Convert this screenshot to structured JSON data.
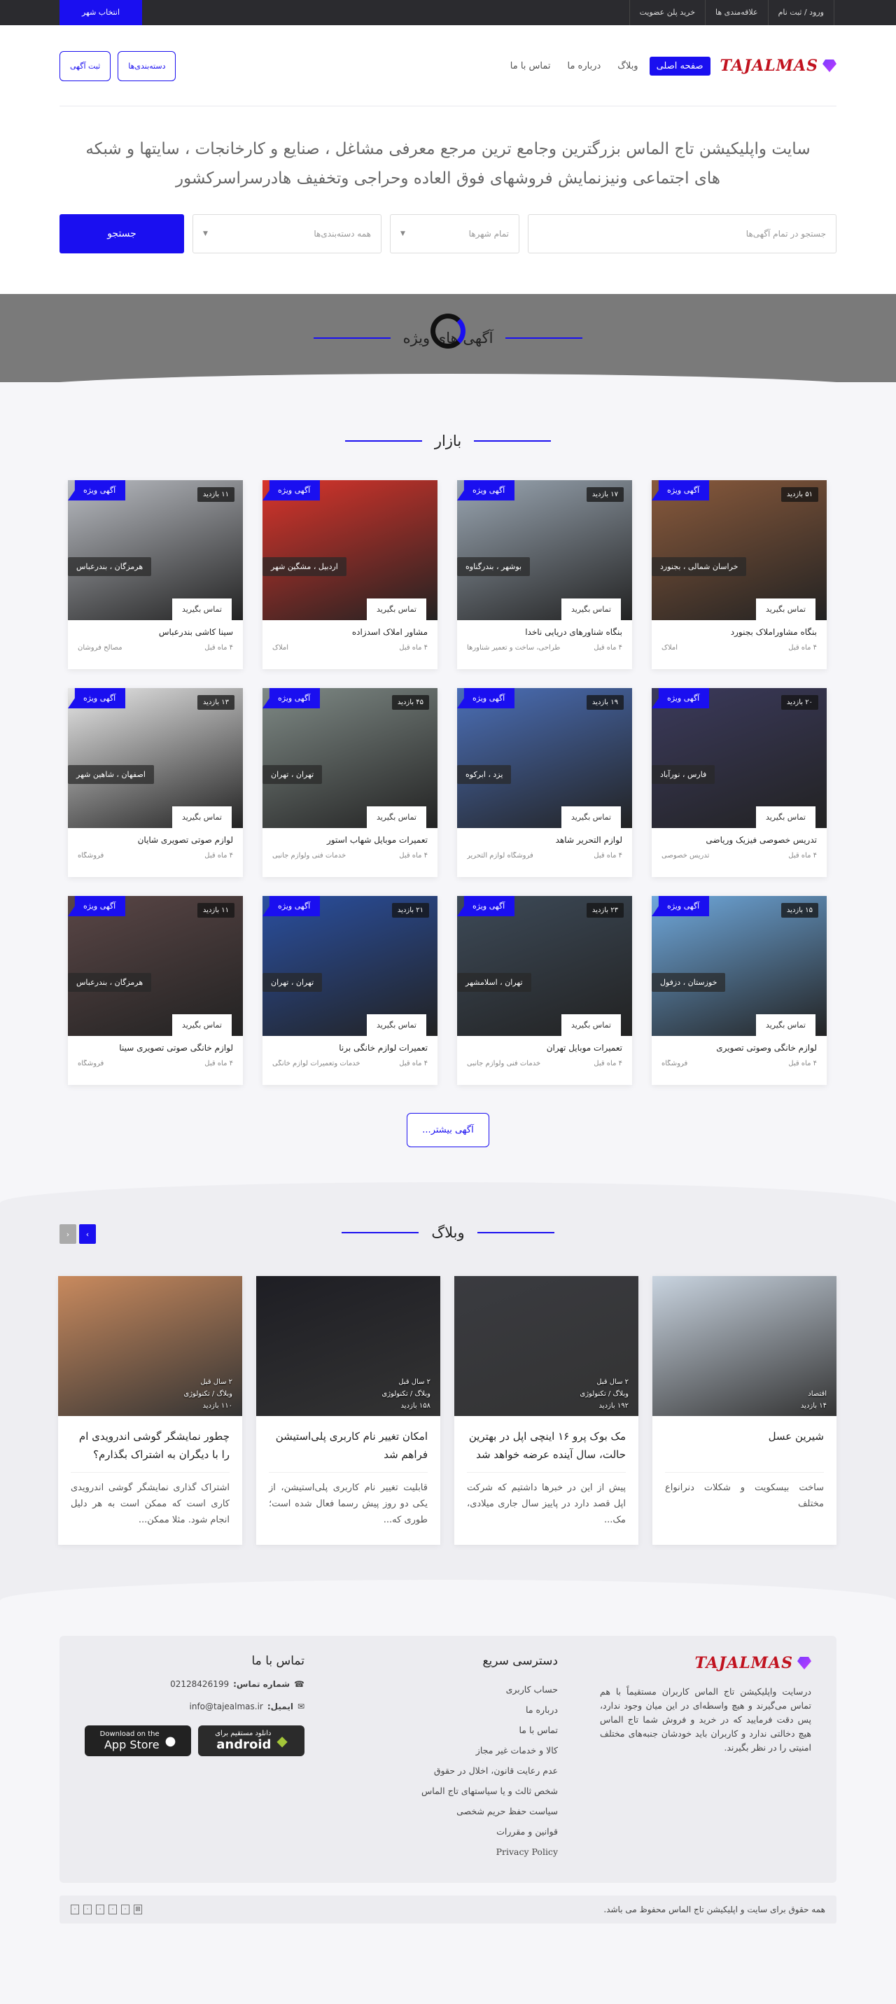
{
  "topbar": {
    "links": [
      "ورود / ثبت نام",
      "علاقه‌مندی ها",
      "خرید پلن عضویت"
    ],
    "city_button": "انتخاب شهر"
  },
  "header": {
    "logo": "TAJALMAS",
    "nav": [
      "صفحه اصلی",
      "وبلاگ",
      "درباره ما",
      "تماس با ما"
    ],
    "buttons": [
      "دسته‌بندی‌ها",
      "ثبت آگهی"
    ]
  },
  "hero": {
    "text": "سایت واپلیکیشن تاج الماس بزرگترین وجامع ترین مرجع معرفی مشاغل ، صنایع و کارخانجات ، سایتها و شبکه های اجتماعی  ونیزنمایش فروشهای فوق العاده وحراجی وتخفیف هادرسراسرکشور",
    "search_placeholder": "جستجو در تمام آگهی‌ها",
    "city_select": "تمام شهرها",
    "category_select": "همه دسته‌بندی‌ها",
    "search_button": "جستجو"
  },
  "featured": {
    "title": "آگهی های ویژه"
  },
  "market": {
    "title": "بازار",
    "contact_label": "تماس بگیرید",
    "featured_label": "آگهی ویژه",
    "items": [
      {
        "title": "بنگاه مشاوراملاک بجنورد",
        "location": "خراسان شمالی ، بجنورد",
        "views": "۵۱ بازدید",
        "time": "۴ ماه قبل",
        "category": "املاک",
        "featured": true,
        "color": "#8a5a3c"
      },
      {
        "title": "بنگاه شناورهای دریایی ناخدا",
        "location": "بوشهر ، بندرگناوه",
        "views": "۱۷ بازدید",
        "time": "۴ ماه قبل",
        "category": "طراحی، ساخت و تعمیر شناورها",
        "featured": true,
        "color": "#9aa6b2"
      },
      {
        "title": "مشاور املاک اسدزاده",
        "location": "اردبیل ، مشگین شهر",
        "views": "",
        "time": "۴ ماه قبل",
        "category": "املاک",
        "featured": true,
        "color": "#d9342b"
      },
      {
        "title": "سینا کاشی بندرعباس",
        "location": "هرمزگان ، بندرعباس",
        "views": "۱۱ بازدید",
        "time": "۴ ماه قبل",
        "category": "مصالح فروشان",
        "featured": true,
        "color": "#b9bcc2"
      },
      {
        "title": "تدریس خصوصی فیزیک وریاضی",
        "location": "فارس ، نورآباد",
        "views": "۲۰ بازدید",
        "time": "۴ ماه قبل",
        "category": "تدریس خصوصی",
        "featured": true,
        "color": "#3b3a5c"
      },
      {
        "title": "لوازم التحریر شاهد",
        "location": "یزد ، ابرکوه",
        "views": "۱۹ بازدید",
        "time": "۴ ماه قبل",
        "category": "فروشگاه لوازم التحریر",
        "featured": true,
        "color": "#4b6fb8"
      },
      {
        "title": "تعمیرات موبایل شهاب استور",
        "location": "تهران ، تهران",
        "views": "۴۵ بازدید",
        "time": "۴ ماه قبل",
        "category": "خدمات فنی ولوازم جانبی",
        "featured": true,
        "color": "#7f8a86"
      },
      {
        "title": "لوازم صوتی تصویری شایان",
        "location": "اصفهان ، شاهین شهر",
        "views": "۱۳ بازدید",
        "time": "۴ ماه قبل",
        "category": "فروشگاه",
        "featured": true,
        "color": "#e8e8e8"
      },
      {
        "title": "لوازم خانگی وصوتی تصویری",
        "location": "خوزستان ، دزفول",
        "views": "۱۵ بازدید",
        "time": "۴ ماه قبل",
        "category": "فروشگاه",
        "featured": true,
        "color": "#6fa8dc"
      },
      {
        "title": "تعمیرات موبایل تهران",
        "location": "تهران ، اسلامشهر",
        "views": "۲۳ بازدید",
        "time": "۴ ماه قبل",
        "category": "خدمات فنی ولوازم جانبی",
        "featured": true,
        "color": "#3d4a58"
      },
      {
        "title": "تعمیرات لوازم خانگی برنا",
        "location": "تهران ، تهران",
        "views": "۲۱ بازدید",
        "time": "۴ ماه قبل",
        "category": "خدمات وتعمیرات لوازم خانگی",
        "featured": true,
        "color": "#2a4fa0"
      },
      {
        "title": "لوازم خانگی صوتی تصویری سینا",
        "location": "هرمزگان ، بندرعباس",
        "views": "۱۱ بازدید",
        "time": "۴ ماه قبل",
        "category": "فروشگاه",
        "featured": true,
        "color": "#5a4646"
      }
    ],
    "more_button": "آگهی بیشتر..."
  },
  "blog": {
    "title": "وبلاگ",
    "posts": [
      {
        "title": "شیرین عسل",
        "excerpt": "ساخت بیسکویت و شکلات دنرانواع مختلف",
        "date": "",
        "category": "اقتصاد",
        "views": "۱۴ بازدید",
        "color": "#c9d4e0"
      },
      {
        "title": "مک بوک پرو ۱۶ اینچی اپل در بهترین حالت، سال آینده عرضه خواهد شد",
        "excerpt": "پیش از این در خبرها داشتیم که شرکت اپل قصد دارد در پاییز سال جاری میلادی، مک...",
        "date": "۲ سال قبل",
        "category": "وبلاگ / تکنولوژی",
        "views": "۱۹۲ بازدید",
        "color": "#3a3b40"
      },
      {
        "title": "امکان تغییر نام کاربری پلی‌استیشن فراهم شد",
        "excerpt": "قابلیت تغییر نام کاربری پلی‌استیشن، از یکی دو روز پیش رسما فعال شده است؛ طوری که...",
        "date": "۲ سال قبل",
        "category": "وبلاگ / تکنولوژی",
        "views": "۱۵۸ بازدید",
        "color": "#1e1e24"
      },
      {
        "title": "چطور نمایشگر گوشی اندرویدی ام را با دیگران به اشتراک بگذارم؟",
        "excerpt": "اشتراک گذاری نمایشگر گوشی اندرویدی کاری است که ممکن است به هر دلیل انجام شود. مثلا ممکن...",
        "date": "۲ سال قبل",
        "category": "وبلاگ / تکنولوژی",
        "views": "۱۱۰ بازدید",
        "color": "#c98a5e"
      }
    ]
  },
  "footer": {
    "logo": "TAJALMAS",
    "about": "درسایت واپلیکیشن تاج الماس کاربران مستقیماً با هم تماس می‌گیرند و هیچ واسطه‌ای در این میان وجود ندارد، پس دقت فرمایید که در خرید و فروش شما تاج الماس هیچ دخالتی ندارد و کاربران باید خودشان جنبه‌های مختلف امنیتی را در نظر بگیرند.",
    "quick_title": "دسترسی سریع",
    "quick_links": [
      "حساب کاربری",
      "درباره ما",
      "تماس با ما",
      "کالا و خدمات غیر مجاز",
      "عدم رعایت قانون، اخلال در حقوق",
      "شخص ثالث و یا سیاستهای تاج الماس",
      "سیاست حفظ حریم شخصی",
      "قوانین و مقررات",
      "Privacy Policy"
    ],
    "contact_title": "تماس با ما",
    "phone_label": "شماره تماس:",
    "phone": "02128426199",
    "email_label": "ایمیل:",
    "email": "info@tajealmas.ir",
    "android_small": "دانلود مستقیم برای",
    "android_big": "android",
    "ios_small": "Download on the",
    "ios_big": "App Store",
    "copyright": "همه حقوق برای سایت و اپلیکیشن تاج الماس محفوظ می باشد."
  }
}
